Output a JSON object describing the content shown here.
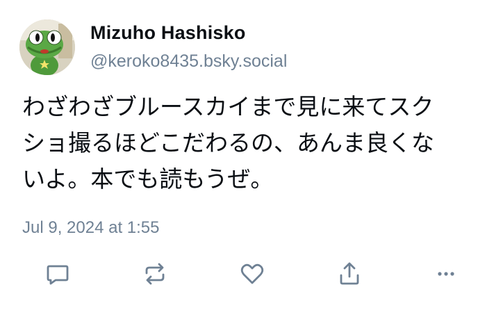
{
  "post": {
    "author": {
      "display_name": "Mizuho Hashisko",
      "handle": "@keroko8435.bsky.social",
      "avatar_icon": "frog-character-avatar"
    },
    "text": "わざわざブルースカイまで見に来てスク\nショ撮るほどこだわるの、あんま良くな\nいよ。本でも読もうぜ。",
    "timestamp": "Jul 9, 2024 at 1:55"
  },
  "actions": [
    {
      "name": "reply",
      "icon": "reply-icon"
    },
    {
      "name": "repost",
      "icon": "repost-icon"
    },
    {
      "name": "like",
      "icon": "heart-icon"
    },
    {
      "name": "share",
      "icon": "share-icon"
    },
    {
      "name": "more",
      "icon": "more-options-icon"
    }
  ],
  "colors": {
    "text_primary": "#0b0f14",
    "text_secondary": "#6f8194",
    "icon": "#6f8194",
    "background": "#ffffff"
  }
}
